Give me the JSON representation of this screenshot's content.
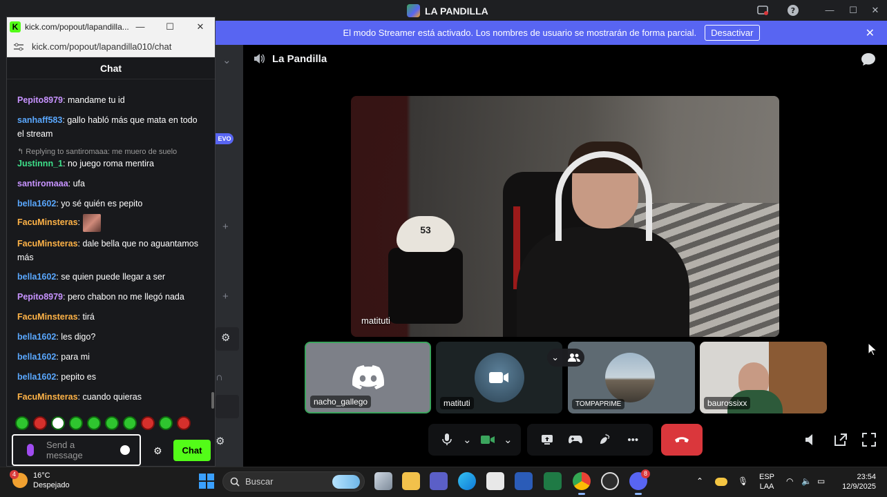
{
  "discord": {
    "window_title": "LA PANDILLA",
    "streamer_banner": {
      "text": "El modo Streamer está activado. Los nombres de usuario se mostrarán de forma parcial.",
      "button": "Desactivar"
    },
    "sidebar_badge": "EVO",
    "channel_name": "La Pandilla",
    "main_video_label": "matituti",
    "participants": [
      {
        "name": "nacho_gallego"
      },
      {
        "name": "matituti"
      },
      {
        "name": "TOMPAPRIME"
      },
      {
        "name": "baurossixx"
      }
    ],
    "stool_number": "53"
  },
  "kick": {
    "tab_title": "kick.com/popout/lapandilla...",
    "url": "kick.com/popout/lapandilla010/chat",
    "chat_header": "Chat",
    "messages": [
      {
        "user": "Pepito8979",
        "text": ": mandame tu id",
        "color": "#c793ff"
      },
      {
        "user": "sanhaff583",
        "text": ": gallo habló más que mata en todo el stream",
        "color": "#5aa8ff"
      },
      {
        "reply": "Replying to santiromaaa: me muero de suelo"
      },
      {
        "user": "Justinnn_1",
        "text": ": no juego roma mentira",
        "color": "#3ee08a"
      },
      {
        "user": "santiromaaa",
        "text": ": ufa",
        "color": "#c793ff"
      },
      {
        "user": "bella1602",
        "text": ": yo sé quién es pepito",
        "color": "#5aa8ff"
      },
      {
        "user": "FacuMinsteras",
        "text": ":",
        "color": "#ffb347"
      },
      {
        "user": "FacuMinsteras",
        "text": ": dale bella que no aguantamos más",
        "color": "#ffb347"
      },
      {
        "user": "bella1602",
        "text": ": se quien puede llegar a ser",
        "color": "#5aa8ff"
      },
      {
        "user": "Pepito8979",
        "text": ": pero chabon no me llegó nada",
        "color": "#c793ff"
      },
      {
        "user": "FacuMinsteras",
        "text": ": tirá",
        "color": "#ffb347"
      },
      {
        "user": "bella1602",
        "text": ": les digo?",
        "color": "#5aa8ff"
      },
      {
        "user": "bella1602",
        "text": ": para mi",
        "color": "#5aa8ff"
      },
      {
        "user": "bella1602",
        "text": ": pepito es",
        "color": "#5aa8ff"
      },
      {
        "user": "FacuMinsteras",
        "text": ": cuando quieras",
        "color": "#ffb347"
      }
    ],
    "input_placeholder": "Send a message",
    "chat_button": "Chat"
  },
  "taskbar": {
    "weather_temp": "16°C",
    "weather_desc": "Despejado",
    "weather_badge": "4",
    "search_placeholder": "Buscar",
    "lang_top": "ESP",
    "lang_bottom": "LAA",
    "time": "23:54",
    "date": "12/9/2025",
    "discord_badge": "8"
  },
  "colors": {
    "discord_blurple": "#5865f2",
    "kick_green": "#53fc18",
    "hangup_red": "#da373c",
    "speaking_green": "#3ba55d"
  }
}
